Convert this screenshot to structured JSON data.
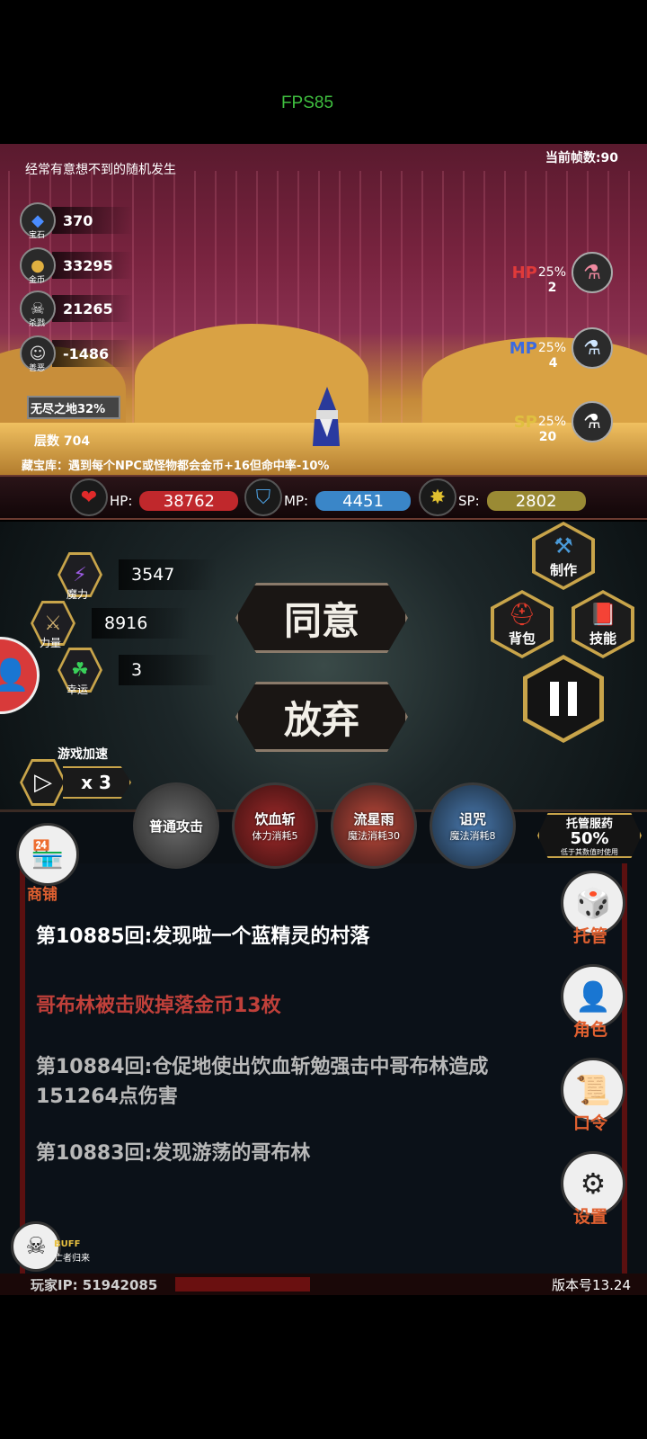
{
  "fps": "FPS85",
  "header": {
    "tip": "经常有意想不到的随机发生",
    "framerate": "当前帧数:90"
  },
  "resources": [
    {
      "icon": "gem-icon",
      "label": "宝石",
      "value": "370"
    },
    {
      "icon": "coin-icon",
      "label": "金币",
      "value": "33295"
    },
    {
      "icon": "skull-icon",
      "label": "杀戮",
      "value": "21265"
    },
    {
      "icon": "mask-icon",
      "label": "善恶",
      "value": "-1486"
    }
  ],
  "zone": {
    "name": "无尽之地32%",
    "floor_label": "层数",
    "floor_value": "704"
  },
  "treasure": "藏宝库：遇到每个NPC或怪物都会金币+16但命中率-10%",
  "potions": [
    {
      "label": "HP",
      "pct": "25%",
      "count": "2",
      "color": "#e03a3a"
    },
    {
      "label": "MP",
      "pct": "25%",
      "count": "4",
      "color": "#3a6ae0"
    },
    {
      "label": "SP",
      "pct": "25%",
      "count": "20",
      "color": "#e0c040"
    }
  ],
  "stats": {
    "hp": {
      "label": "HP:",
      "value": "38762",
      "color": "#c0282c"
    },
    "mp": {
      "label": "MP:",
      "value": "4451",
      "color": "#3a86c8"
    },
    "sp": {
      "label": "SP:",
      "value": "2802",
      "color": "#9a8a34"
    }
  },
  "attributes": [
    {
      "label": "魔力",
      "value": "3547"
    },
    {
      "label": "力量",
      "value": "8916"
    },
    {
      "label": "幸运",
      "value": "3"
    }
  ],
  "actions": {
    "agree": "同意",
    "abandon": "放弃"
  },
  "menu": {
    "craft": "制作",
    "bag": "背包",
    "skills": "技能"
  },
  "speed": {
    "label": "游戏加速",
    "value": "x 3"
  },
  "skills": [
    {
      "name": "普通攻击",
      "cost": ""
    },
    {
      "name": "饮血斩",
      "cost": "体力消耗5"
    },
    {
      "name": "流星雨",
      "cost": "魔法消耗30"
    },
    {
      "name": "诅咒",
      "cost": "魔法消耗8"
    }
  ],
  "auto": {
    "title": "托管服药",
    "pct": "50%",
    "sub": "低于其数值时使用"
  },
  "shop": "商铺",
  "side": {
    "auto": "托管",
    "role": "角色",
    "code": "口令",
    "settings": "设置"
  },
  "log": [
    {
      "text": "第10885回:发现啦一个蓝精灵的村落",
      "color": "#ffffff"
    },
    {
      "text": "哥布林被击败掉落金币13枚",
      "color": "#c0403a"
    },
    {
      "text": "第10884回:仓促地使出饮血斩勉强击中哥布林造成151264点伤害",
      "color": "#b8b8b8"
    },
    {
      "text": "第10883回:发现游荡的哥布林",
      "color": "#b8b8b8"
    }
  ],
  "buff": {
    "title": "BUFF",
    "name": "亡者归来"
  },
  "footer": {
    "ip": "玩家IP: 51942085",
    "version": "版本号13.24"
  }
}
